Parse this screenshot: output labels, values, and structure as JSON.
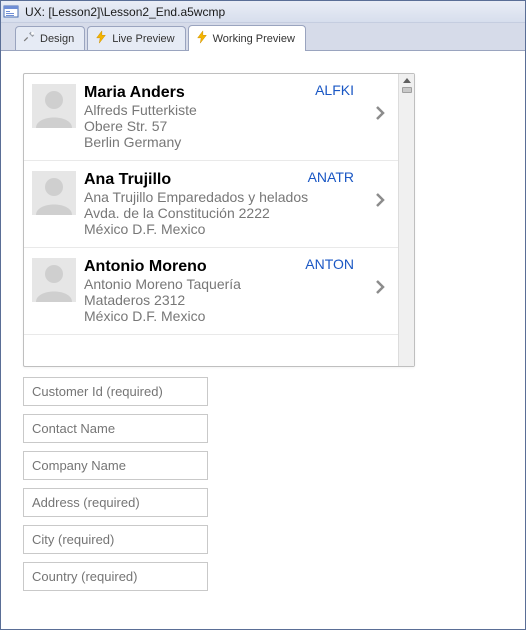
{
  "window": {
    "title": "UX: [Lesson2]\\Lesson2_End.a5wcmp"
  },
  "tabs": {
    "design": "Design",
    "live": "Live Preview",
    "working": "Working Preview"
  },
  "list": {
    "rows": [
      {
        "name": "Maria Anders",
        "company": "Alfreds Futterkiste",
        "addr": "Obere Str. 57",
        "city": "Berlin Germany",
        "code": "ALFKI"
      },
      {
        "name": "Ana Trujillo",
        "company": "Ana Trujillo Emparedados y helados",
        "addr": "Avda. de la Constitución 2222",
        "city": "México D.F. Mexico",
        "code": "ANATR"
      },
      {
        "name": "Antonio Moreno",
        "company": "Antonio Moreno Taquería",
        "addr": "Mataderos 2312",
        "city": "México D.F. Mexico",
        "code": "ANTON"
      }
    ]
  },
  "form": {
    "customer_id": {
      "placeholder": "Customer Id (required)"
    },
    "contact_name": {
      "placeholder": "Contact Name"
    },
    "company_name": {
      "placeholder": "Company Name"
    },
    "address": {
      "placeholder": "Address (required)"
    },
    "city": {
      "placeholder": "City (required)"
    },
    "country": {
      "placeholder": "Country (required)"
    }
  }
}
